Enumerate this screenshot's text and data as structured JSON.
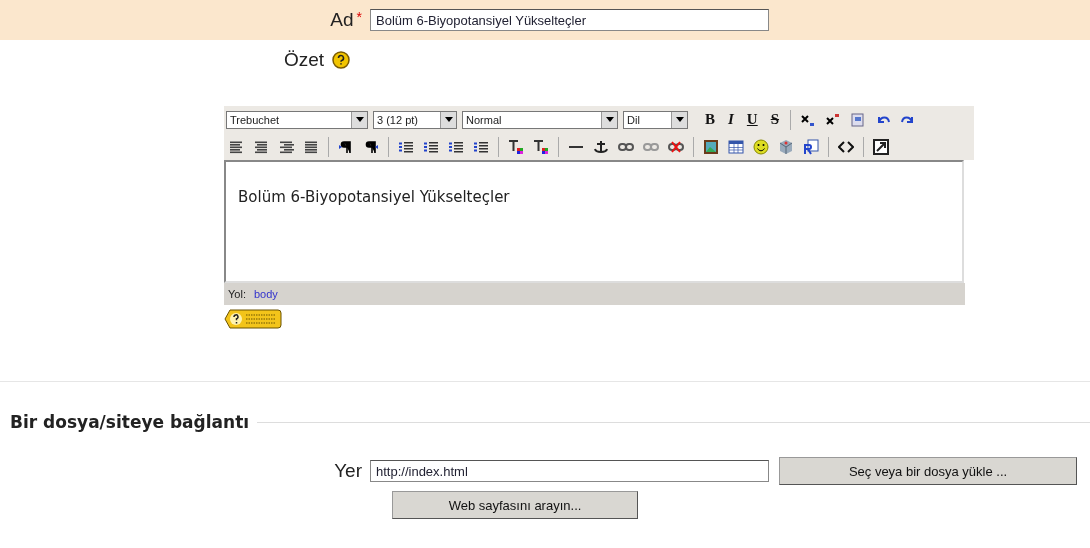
{
  "name_field": {
    "label": "Ad",
    "required_mark": "*",
    "value": "Bolüm 6-Biyopotansiyel Yükselteçler"
  },
  "summary": {
    "label": "Özet"
  },
  "editor": {
    "selects": [
      {
        "value": "Trebuchet"
      },
      {
        "value": "3 (12 pt)"
      },
      {
        "value": "Normal"
      },
      {
        "value": "Dil"
      }
    ],
    "format_buttons": [
      "B",
      "I",
      "U",
      "S"
    ],
    "content": "Bolüm 6-Biyopotansiyel Yükselteçler",
    "path_label": "Yol:",
    "path_link": "body"
  },
  "section": {
    "heading": "Bir dosya/siteye bağlantı"
  },
  "location": {
    "label": "Yer",
    "value": "http://index.html",
    "choose_button": "Seç veya bir dosya yükle ...",
    "search_button": "Web sayfasını arayın..."
  }
}
